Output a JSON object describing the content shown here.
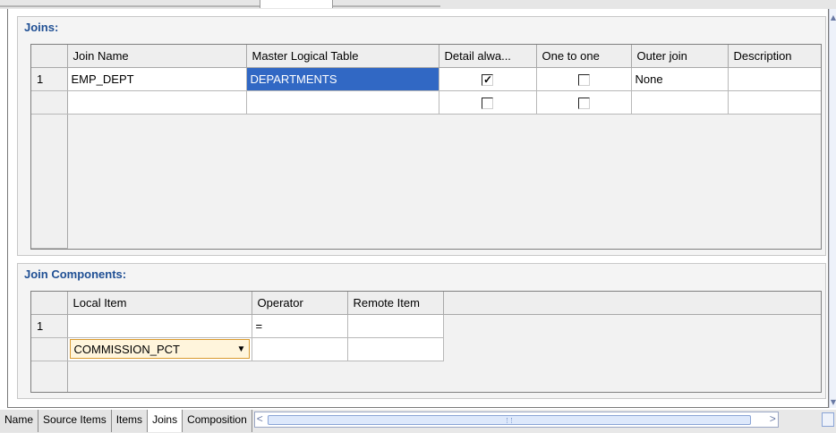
{
  "joins": {
    "title": "Joins:",
    "columns": [
      "Join Name",
      "Master Logical Table",
      "Detail alwa...",
      "One to one",
      "Outer join",
      "Description"
    ],
    "rows": [
      {
        "num": "1",
        "join_name": "EMP_DEPT",
        "master_table": "DEPARTMENTS",
        "detail_always": true,
        "one_to_one": false,
        "outer_join": "None",
        "description": ""
      },
      {
        "num": "",
        "join_name": "",
        "master_table": "",
        "detail_always": false,
        "one_to_one": false,
        "outer_join": "",
        "description": ""
      }
    ]
  },
  "join_components": {
    "title": "Join Components:",
    "columns": [
      "Local Item",
      "Operator",
      "Remote Item"
    ],
    "rows": [
      {
        "num": "1",
        "local_item": "",
        "operator": "=",
        "remote_item": ""
      }
    ],
    "edit_row": {
      "local_item_selected": "COMMISSION_PCT"
    }
  },
  "tabs": [
    {
      "label": "Name",
      "active": false
    },
    {
      "label": "Source Items",
      "active": false
    },
    {
      "label": "Items",
      "active": false
    },
    {
      "label": "Joins",
      "active": true
    },
    {
      "label": "Composition",
      "active": false
    }
  ],
  "colors": {
    "section_title": "#1f4f94",
    "selection": "#3168c4",
    "combo_border": "#d99a2e"
  }
}
